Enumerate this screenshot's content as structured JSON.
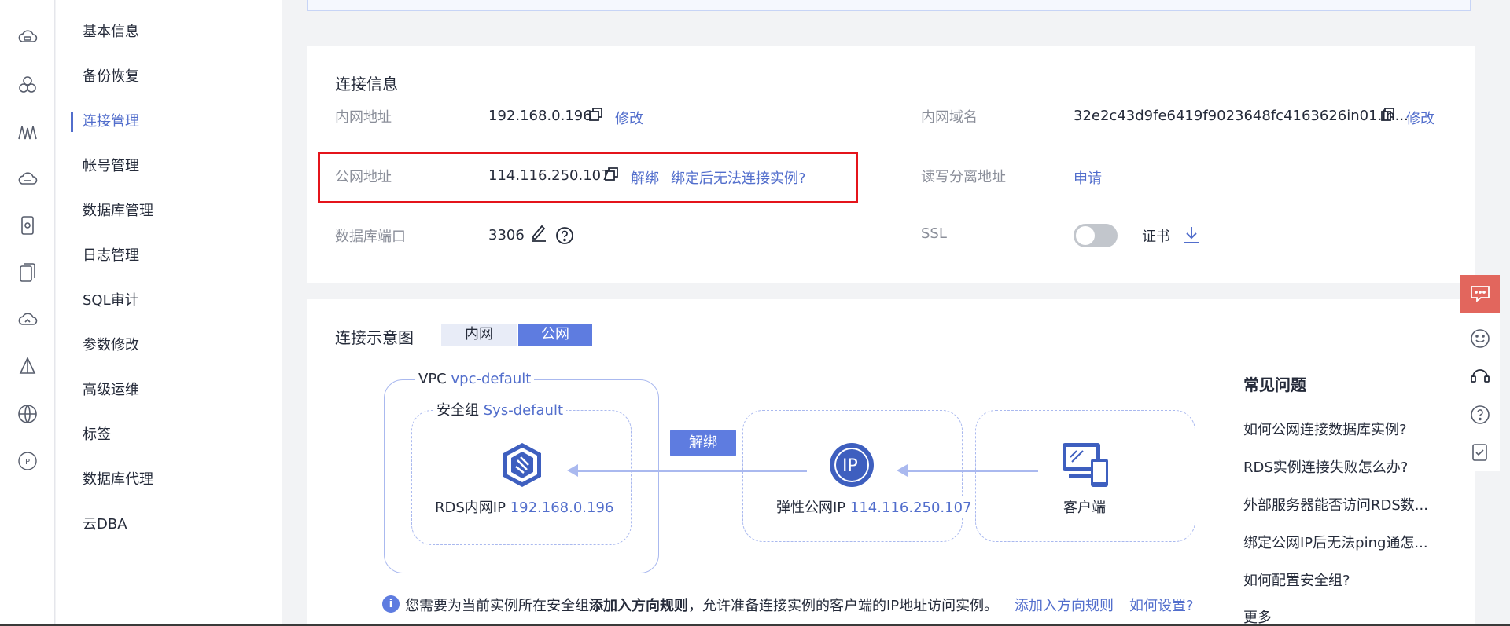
{
  "rail": {
    "icons": [
      "cloud-db-icon",
      "cluster-icon",
      "wave-icon",
      "cloud-drive-icon",
      "cloud-phone-icon",
      "copy-device-icon",
      "cloud-upload-icon",
      "sail-icon",
      "globe-w-icon",
      "ip-icon"
    ]
  },
  "menu": {
    "items": [
      "基本信息",
      "备份恢复",
      "连接管理",
      "帐号管理",
      "数据库管理",
      "日志管理",
      "SQL审计",
      "参数修改",
      "高级运维",
      "标签",
      "数据库代理",
      "云DBA"
    ],
    "active_index": 2
  },
  "connection_info": {
    "title": "连接信息",
    "private_address_label": "内网地址",
    "private_address_value": "192.168.0.196",
    "private_address_edit": "修改",
    "public_address_label": "公网地址",
    "public_address_value": "114.116.250.107",
    "public_address_unbind": "解绑",
    "public_address_help": "绑定后无法连接实例?",
    "db_port_label": "数据库端口",
    "db_port_value": "3306",
    "private_domain_label": "内网域名",
    "private_domain_value": "32e2c43d9fe6419f9023648fc4163626in01.in...",
    "private_domain_edit": "修改",
    "rw_split_label": "读写分离地址",
    "rw_split_apply": "申请",
    "ssl_label": "SSL",
    "ssl_enabled": false,
    "cert_label": "证书"
  },
  "diagram": {
    "title": "连接示意图",
    "tabs": [
      "内网",
      "公网"
    ],
    "active_tab": 1,
    "vpc_label": "VPC",
    "vpc_name": "vpc-default",
    "sg_label": "安全组",
    "sg_name": "Sys-default",
    "rds_label": "RDS内网IP",
    "rds_ip": "192.168.0.196",
    "unbind_button": "解绑",
    "eip_label": "弹性公网IP",
    "eip_ip": "114.116.250.107",
    "client_label": "客户端"
  },
  "faq": {
    "title": "常见问题",
    "items": [
      "如何公网连接数据库实例?",
      "RDS实例连接失败怎么办?",
      "外部服务器能否访问RDS数...",
      "绑定公网IP后无法ping通怎...",
      "如何配置安全组?"
    ],
    "more": "更多"
  },
  "notice": {
    "prefix": "您需要为当前实例所在安全组",
    "bold": "添加入方向规则",
    "suffix": "，允许准备连接实例的客户端的IP地址访问实例。",
    "link1": "添加入方向规则",
    "link2": "如何设置?"
  },
  "colors": {
    "accent": "#526ecc",
    "highlight_border": "#e4141b",
    "chat_button": "#e2665d"
  }
}
